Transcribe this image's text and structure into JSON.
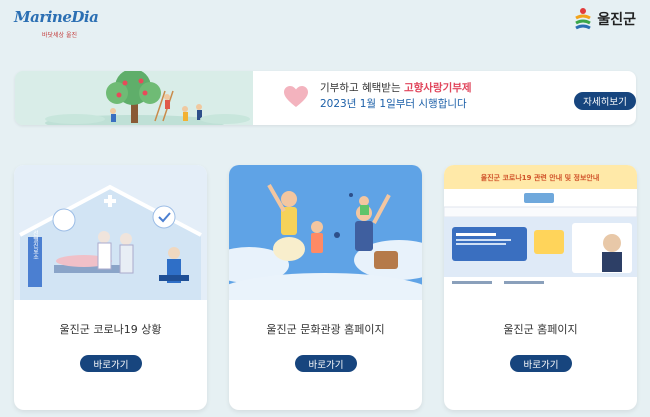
{
  "header": {
    "logo_left_text": "MarineDia",
    "logo_left_sub": "바닷세상 울진",
    "logo_right_text": "울진군"
  },
  "banner": {
    "line1_prefix": "기부하고 혜택받는 ",
    "line1_highlight": "고향사랑기부제",
    "line2": "2023년 1월 1일부터 시행합니다",
    "button_label": "자세히보기"
  },
  "cards": [
    {
      "title": "울진군 코로나19 상황",
      "button_label": "바로가기",
      "thumb_sign": "선별진료소"
    },
    {
      "title": "울진군 문화관광 홈페이지",
      "button_label": "바로가기"
    },
    {
      "title": "울진군 홈페이지",
      "button_label": "바로가기",
      "thumb_banner": "울진군 코로나19 관련 안내 및 정보안내"
    }
  ],
  "colors": {
    "background": "#e6f0f3",
    "button": "#17457e",
    "highlight": "#e0455b",
    "link_blue": "#1b5fa8"
  }
}
